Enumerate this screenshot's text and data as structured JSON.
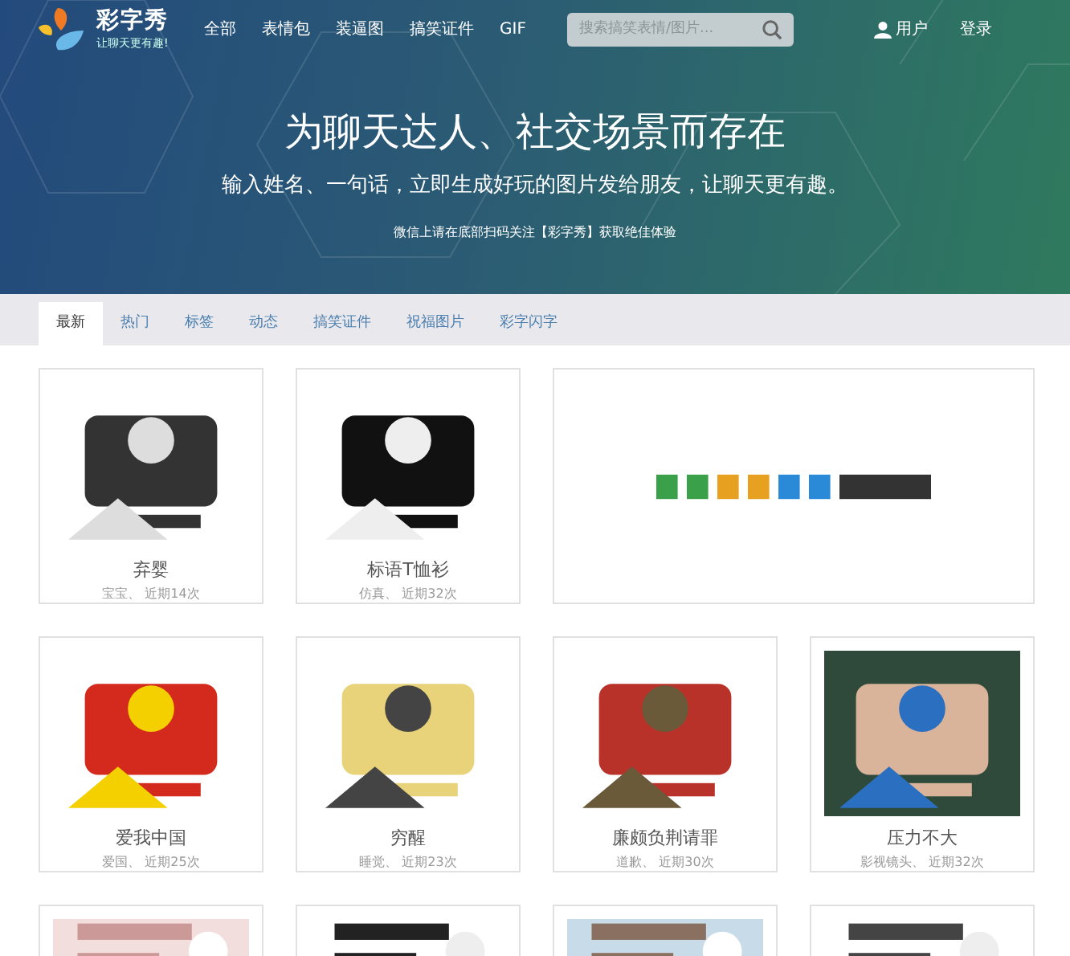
{
  "brand": {
    "name": "彩字秀",
    "slogan": "让聊天更有趣!"
  },
  "nav": [
    {
      "label": "全部"
    },
    {
      "label": "表情包"
    },
    {
      "label": "装逼图"
    },
    {
      "label": "搞笑证件"
    },
    {
      "label": "GIF"
    }
  ],
  "search": {
    "placeholder": "搜索搞笑表情/图片..."
  },
  "user": {
    "label": "用户"
  },
  "login": {
    "label": "登录"
  },
  "hero": {
    "title": "为聊天达人、社交场景而存在",
    "subtitle": "输入姓名、一句话，立即生成好玩的图片发给朋友，让聊天更有趣。",
    "notice": "微信上请在底部扫码关注【彩字秀】获取绝佳体验"
  },
  "tabs": [
    {
      "label": "最新",
      "selected": true
    },
    {
      "label": "热门",
      "selected": false
    },
    {
      "label": "标签",
      "selected": false
    },
    {
      "label": "动态",
      "selected": false
    },
    {
      "label": "搞笑证件",
      "selected": false
    },
    {
      "label": "祝福图片",
      "selected": false
    },
    {
      "label": "彩字闪字",
      "selected": false
    }
  ],
  "cards": [
    {
      "kind": "item",
      "title": "弃婴",
      "meta": "宝宝、 近期14次"
    },
    {
      "kind": "item",
      "title": "标语T恤衫",
      "meta": "仿真、 近期32次"
    },
    {
      "kind": "banner"
    },
    {
      "kind": "item",
      "title": "爱我中国",
      "meta": "爱国、 近期25次"
    },
    {
      "kind": "item",
      "title": "穷醒",
      "meta": "睡觉、 近期23次"
    },
    {
      "kind": "item",
      "title": "廉颇负荆请罪",
      "meta": "道歉、 近期30次"
    },
    {
      "kind": "item",
      "title": "压力不大",
      "meta": "影视镜头、 近期32次"
    },
    {
      "kind": "partial"
    },
    {
      "kind": "partial"
    },
    {
      "kind": "partial"
    },
    {
      "kind": "partial"
    }
  ]
}
